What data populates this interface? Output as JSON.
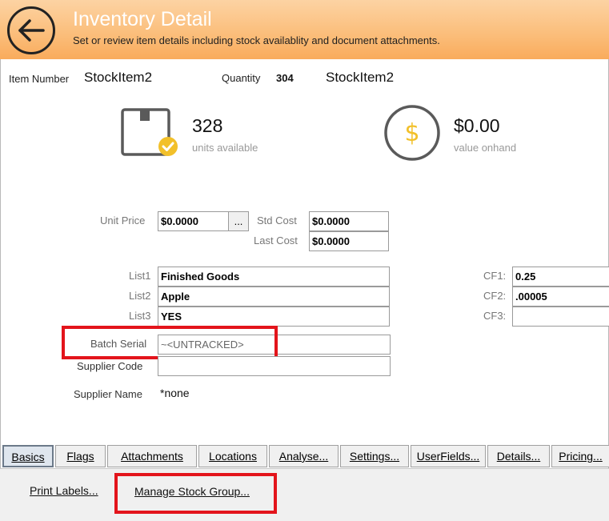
{
  "header": {
    "title": "Inventory Detail",
    "subtitle": "Set or review item details including stock availablity and document attachments."
  },
  "item": {
    "number_label": "Item Number",
    "number": "StockItem2",
    "quantity_label": "Quantity",
    "quantity": "304",
    "description": "StockItem2"
  },
  "stats": {
    "units_value": "328",
    "units_label": "units available",
    "value_onhand": "$0.00",
    "value_label": "value onhand"
  },
  "pricing": {
    "unit_price_label": "Unit Price",
    "unit_price": "$0.0000",
    "ellipsis": "...",
    "std_cost_label": "Std Cost",
    "std_cost": "$0.0000",
    "last_cost_label": "Last Cost",
    "last_cost": "$0.0000"
  },
  "lists": {
    "list1_label": "List1",
    "list1": "Finished Goods",
    "list2_label": "List2",
    "list2": "Apple",
    "list3_label": "List3",
    "list3": "YES"
  },
  "custom_fields": {
    "cf1_label": "CF1:",
    "cf1": "0.25",
    "cf2_label": "CF2:",
    "cf2": ".00005",
    "cf3_label": "CF3:",
    "cf3": ""
  },
  "batch": {
    "batch_serial_label": "Batch Serial",
    "batch_serial": "~<UNTRACKED>",
    "supplier_code_label": "Supplier Code",
    "supplier_code": "",
    "supplier_name_label": "Supplier Name",
    "supplier_name": "*none"
  },
  "tabs": [
    {
      "label": "Basics"
    },
    {
      "label": "Flags"
    },
    {
      "label": "Attachments"
    },
    {
      "label": "Locations"
    },
    {
      "label": "Analyse..."
    },
    {
      "label": "Settings..."
    },
    {
      "label": "UserFields..."
    },
    {
      "label": "Details..."
    },
    {
      "label": "Pricing..."
    }
  ],
  "actions": {
    "print_labels": "Print Labels...",
    "manage_stock_group": "Manage Stock Group..."
  },
  "colors": {
    "header_top": "#fcd3a3",
    "header_bottom": "#f9ab5c",
    "highlight_red": "#e3141b",
    "coin_yellow": "#f2c02a",
    "check_yellow": "#f2c02a"
  },
  "icons": {
    "back": "arrow-left-circle-icon",
    "box": "box-check-icon",
    "coin": "dollar-coin-icon"
  }
}
